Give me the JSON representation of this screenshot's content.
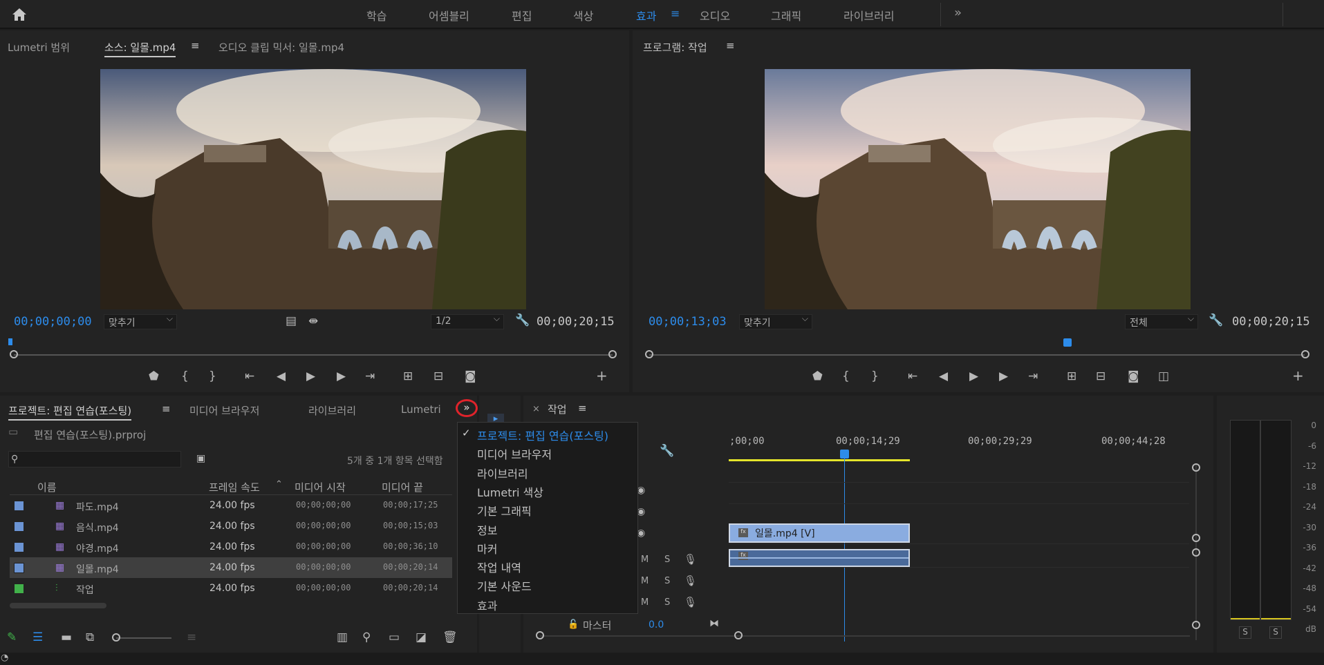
{
  "topbar": {
    "workspaces": [
      "학습",
      "어셈블리",
      "편집",
      "색상",
      "효과",
      "오디오",
      "그래픽",
      "라이브러리"
    ],
    "active_workspace": "효과"
  },
  "source_panel": {
    "tabs": [
      "Lumetri 범위",
      "소스: 일몰.mp4",
      "오디오 클립 믹서: 일몰.mp4"
    ],
    "timecode": "00;00;00;00",
    "fit": "맞추기",
    "resolution": "1/2",
    "duration": "00;00;20;15"
  },
  "program_panel": {
    "title": "프로그램: 작업",
    "timecode": "00;00;13;03",
    "fit": "맞추기",
    "resolution": "전체",
    "duration": "00;00;20;15"
  },
  "project_panel": {
    "tabs": [
      "프로젝트: 편집 연습(포스팅)",
      "미디어 브라우저",
      "라이브러리",
      "Lumetri"
    ],
    "file": "편집 연습(포스팅).prproj",
    "selection_status": "5개 중 1개 항목 선택함",
    "columns": [
      "이름",
      "프레임 속도",
      "미디어 시작",
      "미디어 끝"
    ],
    "rows": [
      {
        "name": "파도.mp4",
        "fps": "24.00 fps",
        "start": "00;00;00;00",
        "end": "00;00;17;25",
        "color": "#6b94d4"
      },
      {
        "name": "음식.mp4",
        "fps": "24.00 fps",
        "start": "00;00;00;00",
        "end": "00;00;15;03",
        "color": "#6b94d4"
      },
      {
        "name": "야경.mp4",
        "fps": "24.00 fps",
        "start": "00;00;00;00",
        "end": "00;00;36;10",
        "color": "#6b94d4"
      },
      {
        "name": "일몰.mp4",
        "fps": "24.00 fps",
        "start": "00;00;00;00",
        "end": "00;00;20;14",
        "color": "#6b94d4"
      },
      {
        "name": "작업",
        "fps": "24.00 fps",
        "start": "00;00;00;00",
        "end": "00;00;20;14",
        "color": "#41b14a"
      }
    ]
  },
  "panel_menu": {
    "items": [
      "프로젝트: 편집 연습(포스팅)",
      "미디어 브라우저",
      "라이브러리",
      "Lumetri 색상",
      "기본 그래픽",
      "정보",
      "마커",
      "작업 내역",
      "기본 사운드",
      "효과"
    ],
    "checked": "프로젝트: 편집 연습(포스팅)",
    "highlighted": "효과"
  },
  "timeline": {
    "tab": "작업",
    "ruler": [
      ";00;00",
      "00;00;14;29",
      "00;00;29;29",
      "00;00;44;28"
    ],
    "clip_label": "일몰.mp4 [V]",
    "track_btn_m": "M",
    "track_btn_s": "S",
    "master_label": "마스터",
    "master_value": "0.0"
  },
  "audio_meter": {
    "scale": [
      "0",
      "-6",
      "-12",
      "-18",
      "-24",
      "-30",
      "-36",
      "-42",
      "-48",
      "-54",
      "dB"
    ],
    "solo": [
      "S",
      "S"
    ]
  }
}
